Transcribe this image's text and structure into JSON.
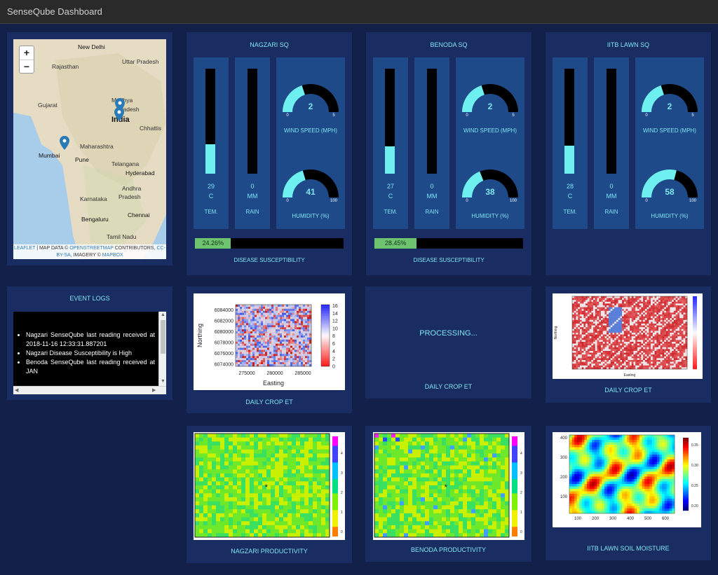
{
  "app": {
    "title": "SenseQube Dashboard"
  },
  "map": {
    "zoom_in": "+",
    "zoom_out": "−",
    "labels": [
      "New Delhi",
      "Rajasthan",
      "Uttar Pradesh",
      "Gujarat",
      "Madhya",
      "Pradesh",
      "India",
      "Chhattis",
      "Maharashtra",
      "Mumbai",
      "Pune",
      "Telangana",
      "Hyderabad",
      "Andhra",
      "Pradesh",
      "Karnataka",
      "Chennai",
      "Bengaluru",
      "Tamil Nadu"
    ],
    "attribution": {
      "leaflet": "LEAFLET",
      "mapdata": " | MAP DATA © ",
      "osm": "OPENSTREETMAP",
      "contrib": " CONTRIBUTORS, ",
      "ccbysa": "CC-BY-SA",
      "imagery": ", IMAGERY © ",
      "mapbox": "MAPBOX"
    }
  },
  "stations": [
    {
      "name": "NAGZARI SQ",
      "temp": "29",
      "temp_unit": "C",
      "temp_label": "TEM.",
      "temp_fill": 0.28,
      "rain": "0",
      "rain_unit": "MM",
      "rain_label": "RAIN",
      "wind": 2,
      "wind_min": "0",
      "wind_max": "5",
      "wind_label": "WIND SPEED (MPH)",
      "humidity": 41,
      "hum_min": "0",
      "hum_max": "100",
      "hum_label": "HUMIDITY (%)",
      "disease": "24.26%",
      "disease_frac": 0.2426,
      "disease_label": "DISEASE SUSCEPTIBILITY"
    },
    {
      "name": "BENODA SQ",
      "temp": "27",
      "temp_unit": "C",
      "temp_label": "TEM.",
      "temp_fill": 0.26,
      "rain": "0",
      "rain_unit": "MM",
      "rain_label": "RAIN",
      "wind": 2,
      "wind_min": "0",
      "wind_max": "5",
      "wind_label": "WIND SPEED (MPH)",
      "humidity": 38,
      "hum_min": "0",
      "hum_max": "100",
      "hum_label": "HUMIDITY (%)",
      "disease": "28.45%",
      "disease_frac": 0.2845,
      "disease_label": "DISEASE SUSCEPTIBILITY"
    },
    {
      "name": "IITB LAWN SQ",
      "temp": "28",
      "temp_unit": "C",
      "temp_label": "TEM.",
      "temp_fill": 0.27,
      "rain": "0",
      "rain_unit": "MM",
      "rain_label": "RAIN",
      "wind": 2,
      "wind_min": "0",
      "wind_max": "5",
      "wind_label": "WIND SPEED (MPH)",
      "humidity": 58,
      "hum_min": "0",
      "hum_max": "100",
      "hum_label": "HUMIDITY (%)"
    }
  ],
  "event_logs": {
    "title": "EVENT LOGS",
    "items": [
      "Nagzari SenseQube last reading received at 2018-11-16 12:33:31.887201",
      "Nagzari Disease Susceptibility is High",
      "Benoda SenseQube last reading received at JAN"
    ]
  },
  "crop_et": {
    "nagzari_label": "DAILY CROP ET",
    "benoda_label": "DAILY CROP ET",
    "benoda_status": "PROCESSING...",
    "iitb_label": "DAILY CROP ET",
    "plot1": {
      "ylabel": "Northing",
      "xlabel": "Easting",
      "yticks": [
        "6084000",
        "6082000",
        "6080000",
        "6078000",
        "6076000",
        "6074000"
      ],
      "xticks": [
        "275000",
        "280000",
        "285000"
      ],
      "cticks": [
        "16",
        "14",
        "12",
        "10",
        "8",
        "6",
        "4",
        "2",
        "0"
      ]
    },
    "plot2": {
      "ylabel": "Northing",
      "xlabel": "Easting"
    }
  },
  "productivity": {
    "nagzari_label": "NAGZARI PRODUCTIVITY",
    "benoda_label": "BENODA PRODUCTIVITY",
    "marker": "*",
    "cticks": [
      "4",
      "3",
      "2",
      "1",
      "0"
    ]
  },
  "soil": {
    "label": "IITB LAWN SOIL MOISTURE",
    "yticks": [
      "400",
      "300",
      "200",
      "100"
    ],
    "xticks": [
      "100",
      "200",
      "300",
      "400",
      "500",
      "600"
    ],
    "cticks": [
      "0.35",
      "0.30",
      "0.25",
      "0.20"
    ]
  }
}
